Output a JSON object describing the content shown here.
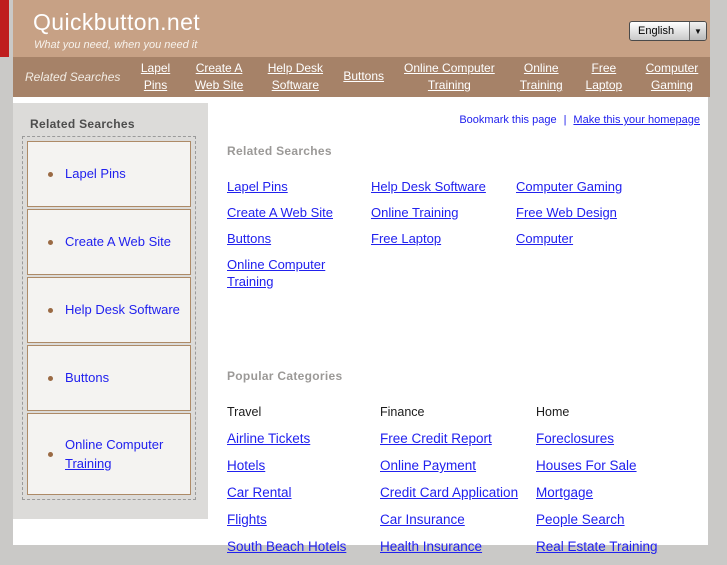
{
  "header": {
    "title": "Quickbutton.net",
    "tagline": "What you need, when you need it",
    "language_selected": "English"
  },
  "nav": {
    "items": [
      {
        "label": "Related Searches"
      },
      {
        "label": "Lapel Pins"
      },
      {
        "label": "Create A Web Site"
      },
      {
        "label": "Help Desk Software"
      },
      {
        "label": "Buttons"
      },
      {
        "label": "Online Computer Training"
      },
      {
        "label": "Online Training"
      },
      {
        "label": "Free Laptop"
      },
      {
        "label": "Computer Gaming"
      }
    ]
  },
  "sidebar": {
    "heading": "Related Searches",
    "items": [
      {
        "label": "Lapel Pins"
      },
      {
        "label": "Create A Web Site"
      },
      {
        "label": "Help Desk Software"
      },
      {
        "label": "Buttons"
      },
      {
        "label": "Online Computer",
        "label2": "Training"
      }
    ]
  },
  "page_actions": {
    "bookmark": "Bookmark this page",
    "separator": "|",
    "homepage": "Make this your homepage"
  },
  "related_searches": {
    "heading": "Related Searches",
    "columns": [
      [
        "Lapel Pins",
        "Create A Web Site",
        "Buttons",
        "Online Computer Training"
      ],
      [
        "Help Desk Software",
        "Online Training",
        "Free Laptop"
      ],
      [
        "Computer Gaming",
        "Free Web Design",
        "Computer"
      ]
    ]
  },
  "popular_categories": {
    "heading": "Popular Categories",
    "columns": [
      {
        "title": "Travel",
        "links": [
          "Airline Tickets",
          "Hotels",
          "Car Rental",
          "Flights",
          "South Beach Hotels"
        ]
      },
      {
        "title": "Finance",
        "links": [
          "Free Credit Report",
          "Online Payment",
          "Credit Card Application",
          "Car Insurance",
          "Health Insurance"
        ]
      },
      {
        "title": "Home",
        "links": [
          "Foreclosures",
          "Houses For Sale",
          "Mortgage",
          "People Search",
          "Real Estate Training"
        ]
      }
    ]
  },
  "colors": {
    "header_bg": "#c7a185",
    "nav_bg": "#a68268",
    "link_blue": "#2121ee",
    "sidebar_bg": "#dcdbd9",
    "sidebar_item_bg": "#f4f3f1",
    "sidebar_item_border": "#ad8a67",
    "page_margin_gray": "#cac9c7",
    "red_stripe": "#bf1d1d"
  }
}
